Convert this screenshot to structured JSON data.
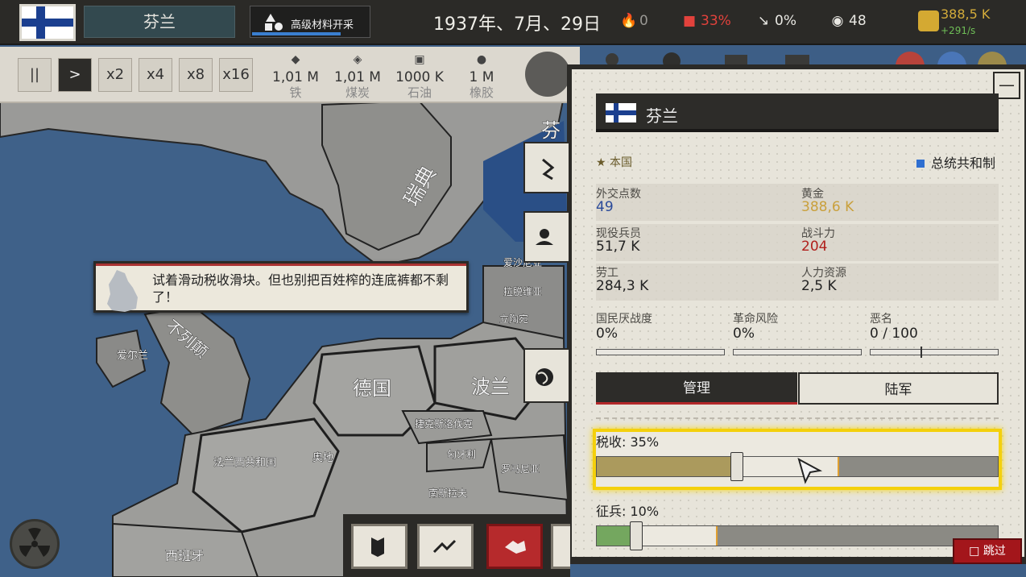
{
  "topbar": {
    "country": "芬兰",
    "research": "高级材料开采",
    "research_progress": 0.74,
    "date": "1937年、7月、29日",
    "fire": "0",
    "territory": "33%",
    "trend": "0%",
    "globe": "48",
    "gold": "388,5 K",
    "gold_income": "+291/s"
  },
  "speed": {
    "pause": "||",
    "play": ">",
    "x2": "x2",
    "x4": "x4",
    "x8": "x8",
    "x16": "x16"
  },
  "resources": [
    {
      "value": "1,01 M",
      "name": "铁"
    },
    {
      "value": "1,01 M",
      "name": "煤炭"
    },
    {
      "value": "1000 K",
      "name": "石油"
    },
    {
      "value": "1 M",
      "name": "橡胶"
    }
  ],
  "map_labels": {
    "sweden": "瑞典",
    "britain": "不列颠",
    "germany": "德国",
    "poland": "波兰",
    "france": "法兰西共和国",
    "finland_short": "芬",
    "austria": "奥地",
    "czech": "捷克斯洛伐克",
    "hungary": "匈牙利",
    "romania": "罗马尼亚",
    "yugoslavia": "南斯拉夫",
    "spain": "西班牙",
    "lithuania": "立陶宛",
    "latvia": "拉脱维亚",
    "estonia": "爱沙尼亚",
    "ireland": "爱尔兰"
  },
  "tutorial": {
    "text": "试着滑动税收滑块。但也别把百姓榨的连底裤都不剩了！"
  },
  "panel": {
    "title": "芬兰",
    "home": "★ 本国",
    "government": "总统共和制",
    "stats": [
      {
        "label": "外交点数",
        "value": "49",
        "color": "#2a4a9a"
      },
      {
        "label": "黄金",
        "value": "388,6 K",
        "color": "#c9a03c"
      },
      {
        "label": "现役兵员",
        "value": "51,7 K",
        "color": "#222222"
      },
      {
        "label": "战斗力",
        "value": "204",
        "color": "#b0201c"
      },
      {
        "label": "劳工",
        "value": "284,3 K",
        "color": "#222222"
      },
      {
        "label": "人力资源",
        "value": "2,5 K",
        "color": "#222222"
      }
    ],
    "war_weariness": {
      "label": "国民厌战度",
      "value": "0%"
    },
    "revolt_risk": {
      "label": "革命风险",
      "value": "0%"
    },
    "infamy": {
      "label": "恶名",
      "value": "0 / 100"
    },
    "tabs": {
      "manage": "管理",
      "army": "陆军"
    },
    "tax": {
      "label": "税收: 35%",
      "value": 0.35
    },
    "conscription": {
      "label": "征兵: 10%",
      "value": 0.1
    }
  },
  "skip": "跳过",
  "colors": {
    "accent_yellow": "#f4d00c",
    "finland_blue": "#1b3f8f",
    "danger_red": "#a3161b"
  }
}
